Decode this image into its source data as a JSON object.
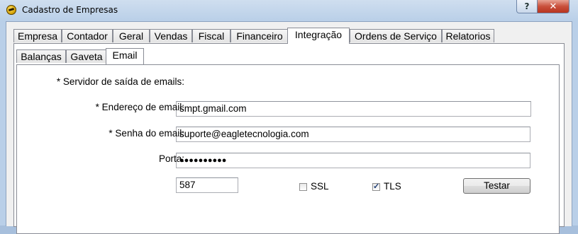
{
  "window": {
    "title": "Cadastro de Empresas",
    "help_label": "?",
    "close_label": "✕",
    "app_icon": "eagle-logo-icon"
  },
  "tabs": [
    {
      "label": "Empresa",
      "active": false
    },
    {
      "label": "Contador",
      "active": false
    },
    {
      "label": "Geral",
      "active": false
    },
    {
      "label": "Vendas",
      "active": false
    },
    {
      "label": "Fiscal",
      "active": false
    },
    {
      "label": "Financeiro",
      "active": false
    },
    {
      "label": "Integração",
      "active": true
    },
    {
      "label": "Ordens de Serviço",
      "active": false
    },
    {
      "label": "Relatorios",
      "active": false
    }
  ],
  "subtabs": [
    {
      "label": "Balanças",
      "active": false
    },
    {
      "label": "Gaveta",
      "active": false
    },
    {
      "label": "Email",
      "active": true
    }
  ],
  "email": {
    "server_label": "* Servidor de saída de emails:",
    "server_value": "smpt.gmail.com",
    "address_label": "* Endereço de email:",
    "address_value": "suporte@eagletecnologia.com",
    "password_label": "* Senha do email:",
    "password_value": "●●●●●●●●●●",
    "port_label": "Porta:",
    "port_value": "587",
    "ssl_label": "SSL",
    "ssl_checked": false,
    "tls_label": "TLS",
    "tls_checked": true,
    "test_button": "Testar"
  }
}
